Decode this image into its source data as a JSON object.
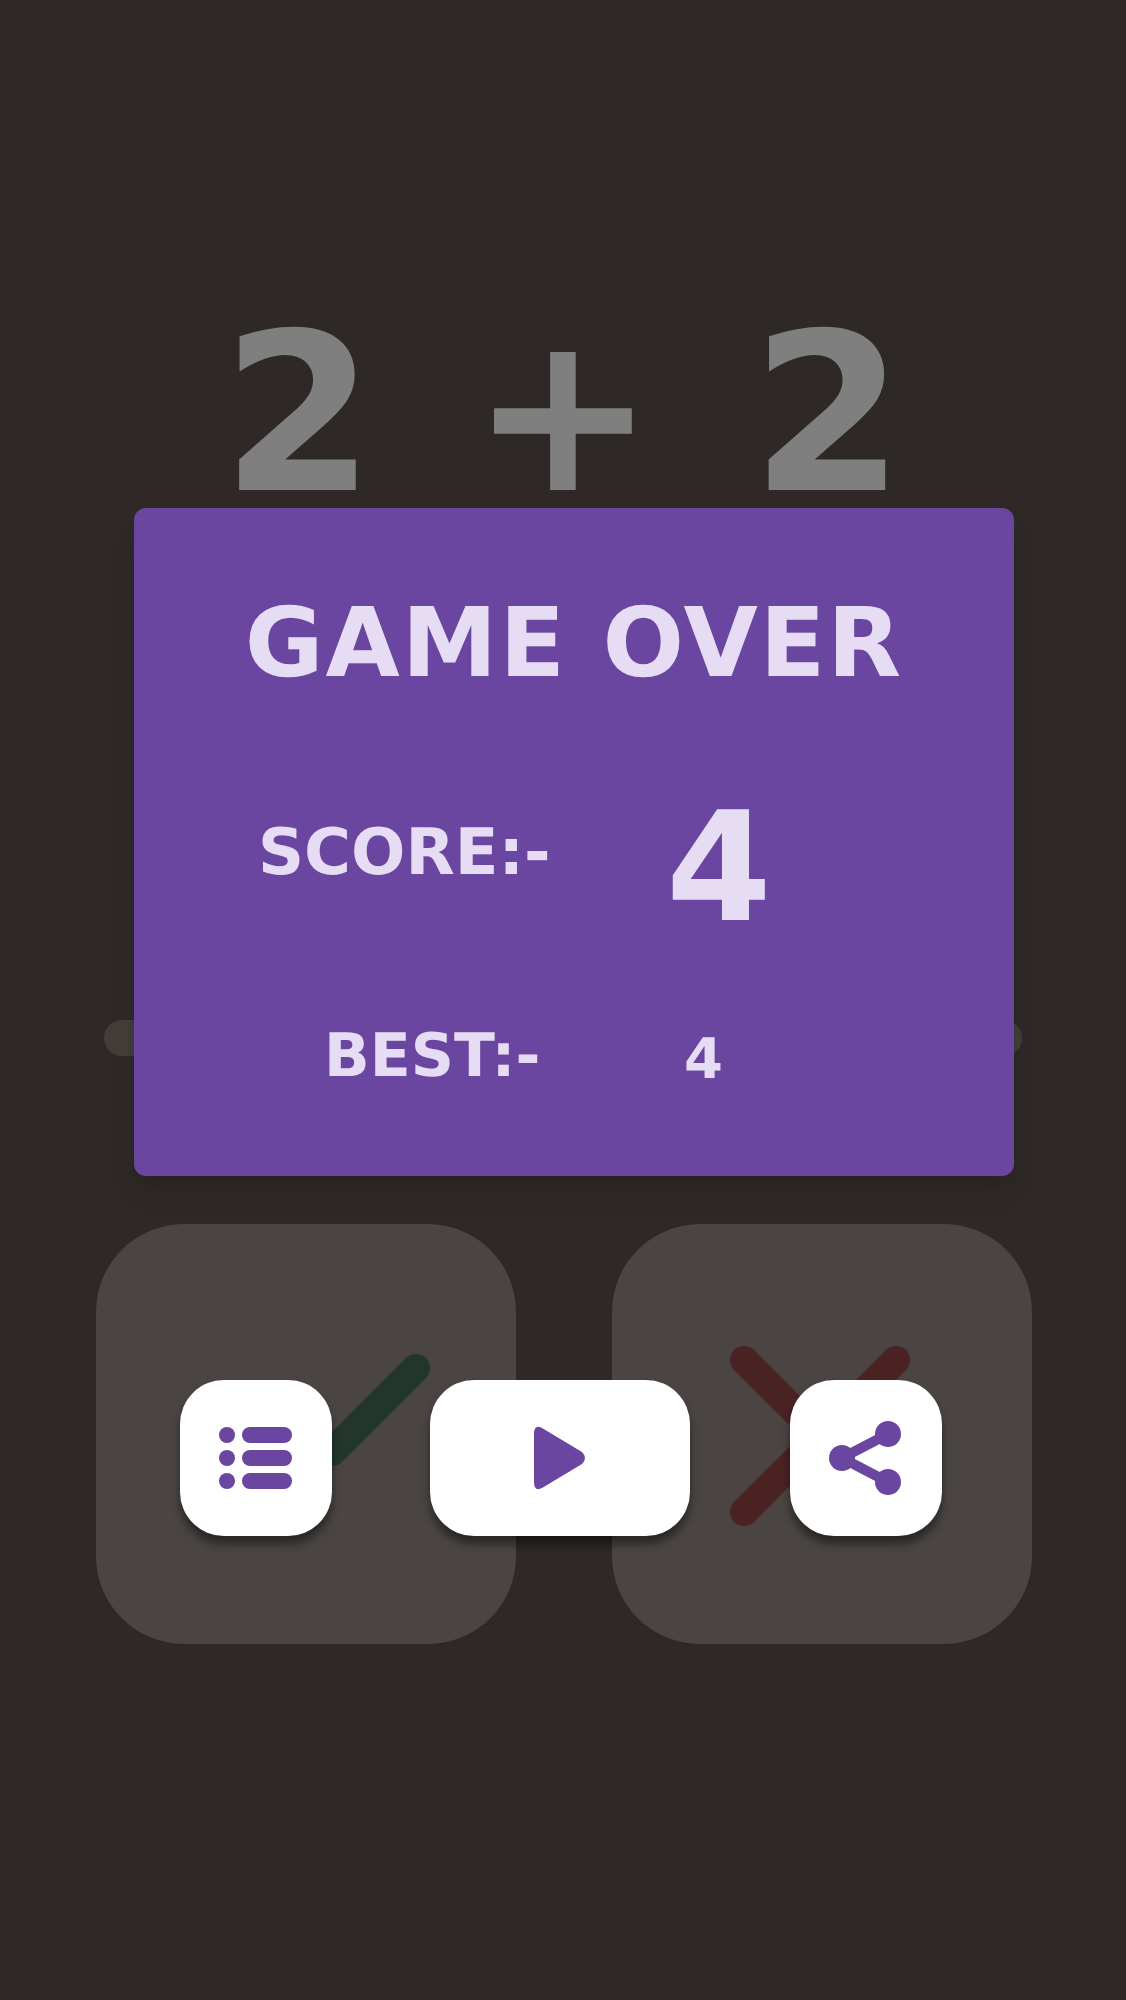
{
  "equation": [
    "2",
    "+",
    "2"
  ],
  "answer_tiles": [
    {
      "kind": "check"
    },
    {
      "kind": "cross"
    }
  ],
  "dialog": {
    "title": "GAME OVER",
    "score_label": "SCORE:-",
    "score": "4",
    "best_label": "BEST:-",
    "best": "4"
  },
  "buttons": [
    {
      "kind": "list"
    },
    {
      "kind": "play"
    },
    {
      "kind": "share"
    }
  ]
}
